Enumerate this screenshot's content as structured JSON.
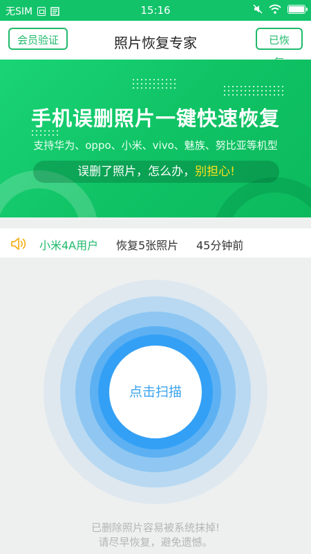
{
  "status_bar": {
    "carrier": "无SIM",
    "time": "15:16",
    "icons": [
      "sim-card-icon",
      "notification-icon",
      "mute-icon",
      "wifi-icon",
      "battery-icon"
    ]
  },
  "header": {
    "left_button": "会员验证",
    "title": "照片恢复专家",
    "right_button": "已恢复",
    "accent_color": "#1fb96a"
  },
  "banner": {
    "headline": "手机误删照片一键快速恢复",
    "subtitle": "支持华为、oppo、小米、vivo、魅族、努比亚等机型",
    "pill_text": "误删了照片，怎么办，",
    "pill_highlight": "别担心!",
    "highlight_color": "#ffe21c"
  },
  "notice": {
    "icon": "speaker-icon",
    "user": "小米4A用户",
    "action": "恢复5张照片",
    "time_ago": "45分钟前"
  },
  "scan": {
    "button_label": "点击扫描",
    "warning_line1": "已删除照片容易被系统抹掉!",
    "warning_line2": "请尽早恢复，避免遗憾。"
  }
}
